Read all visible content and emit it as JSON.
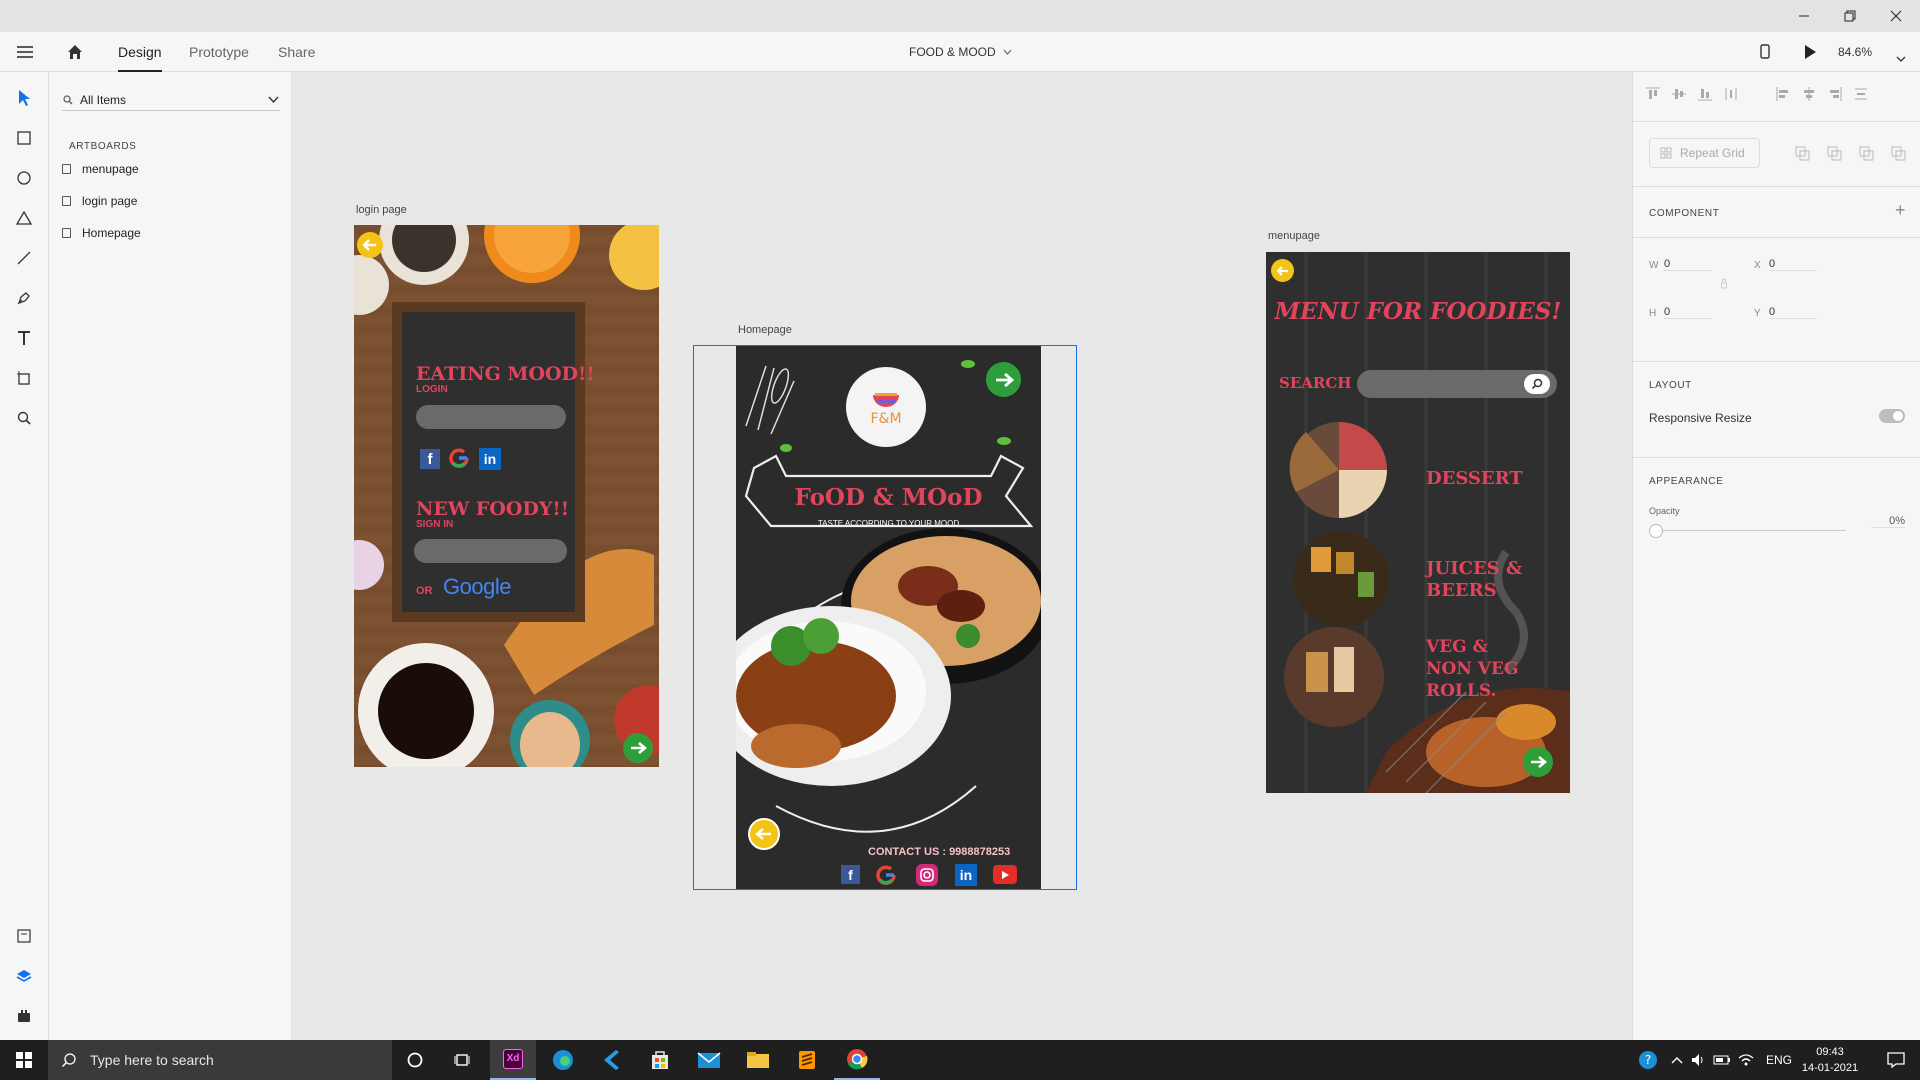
{
  "header": {
    "tabs": [
      {
        "label": "Design"
      },
      {
        "label": "Prototype"
      },
      {
        "label": "Share"
      }
    ],
    "document_title": "FOOD & MOOD",
    "zoom": "84.6%"
  },
  "layers": {
    "filter_label": "All Items",
    "section_title": "ARTBOARDS",
    "items": [
      {
        "label": "menupage"
      },
      {
        "label": "login page"
      },
      {
        "label": "Homepage"
      }
    ]
  },
  "artboards": {
    "login": {
      "label": "login page",
      "eating_mood": "EATING MOOD!!",
      "login": "LOGIN",
      "new_foody": "NEW FOODY!!",
      "sign_in": "SIGN IN",
      "or": "OR",
      "google": "Google"
    },
    "home": {
      "label": "Homepage",
      "logo_text": "F&M",
      "banner_title": "FoOD & MOoD",
      "tagline": "TASTE ACCORDING TO YOUR MOOD",
      "contact": "CONTACT US : 9988878253"
    },
    "menu": {
      "label": "menupage",
      "title": "MENU FOR FOODIES!",
      "search_label": "SEARCH",
      "dessert": "DESSERT",
      "juices_1": "JUICES &",
      "juices_2": "BEERS",
      "veg_1": "VEG &",
      "veg_2": "NON VEG",
      "veg_3": "ROLLS."
    }
  },
  "props": {
    "repeat_grid": "Repeat Grid",
    "component": "COMPONENT",
    "w_label": "W",
    "w_value": "0",
    "x_label": "X",
    "x_value": "0",
    "h_label": "H",
    "h_value": "0",
    "y_label": "Y",
    "y_value": "0",
    "layout": "LAYOUT",
    "responsive_resize": "Responsive Resize",
    "responsive_resize_on": true,
    "appearance": "APPEARANCE",
    "opacity_label": "Opacity",
    "opacity_value": "0%"
  },
  "taskbar": {
    "search_placeholder": "Type here to search",
    "language": "ENG",
    "time": "09:43",
    "date": "14-01-2021"
  },
  "colors": {
    "accent": "#1473e6",
    "brand_red": "#e2445c",
    "board_dark": "#2b2b2b"
  }
}
